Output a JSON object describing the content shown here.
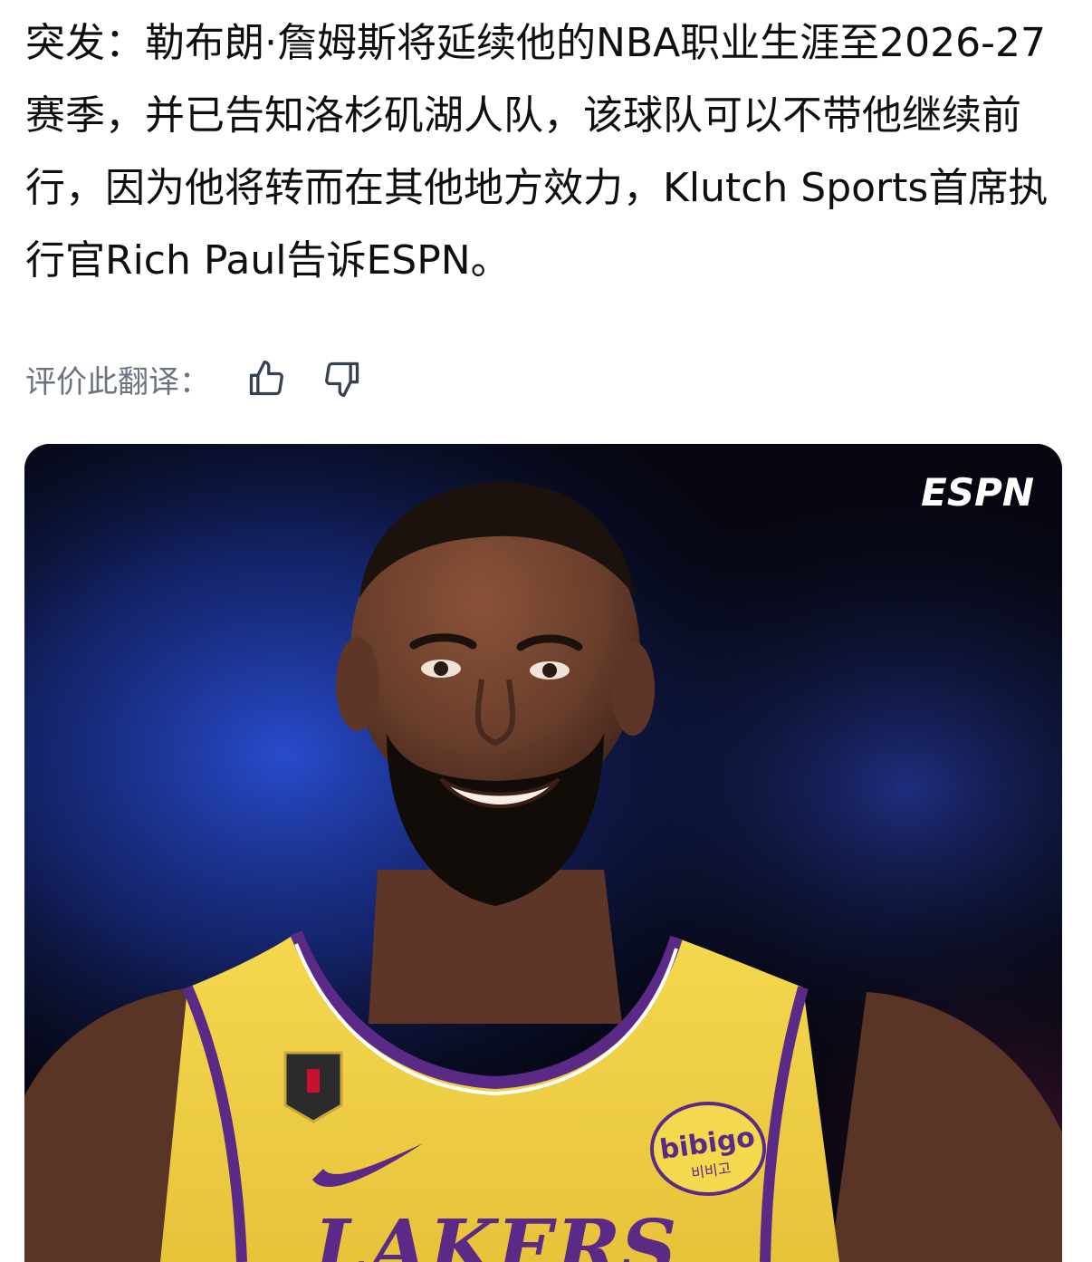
{
  "post": {
    "text": "突发：勒布朗·詹姆斯将延续他的NBA职业生涯至2026-27赛季，并已告知洛杉矶湖人队，该球队可以不带他继续前行，因为他将转而在其他地方效力，Klutch Sports首席执行官Rich Paul告诉ESPN。"
  },
  "rating": {
    "label": "评价此翻译：",
    "thumbs_up_icon": "thumbs-up-icon",
    "thumbs_down_icon": "thumbs-down-icon"
  },
  "media": {
    "watermark": "ESPN",
    "jersey_patch": "bibigo",
    "jersey_patch_korean": "비비고",
    "jersey_wordmark": "LAKERS",
    "colors": {
      "background": "#05060f",
      "blur_blue": "#2a4fd6",
      "jersey_gold": "#f1d24a",
      "jersey_purple": "#5b2a86",
      "skin": "#6a3e2c"
    }
  }
}
